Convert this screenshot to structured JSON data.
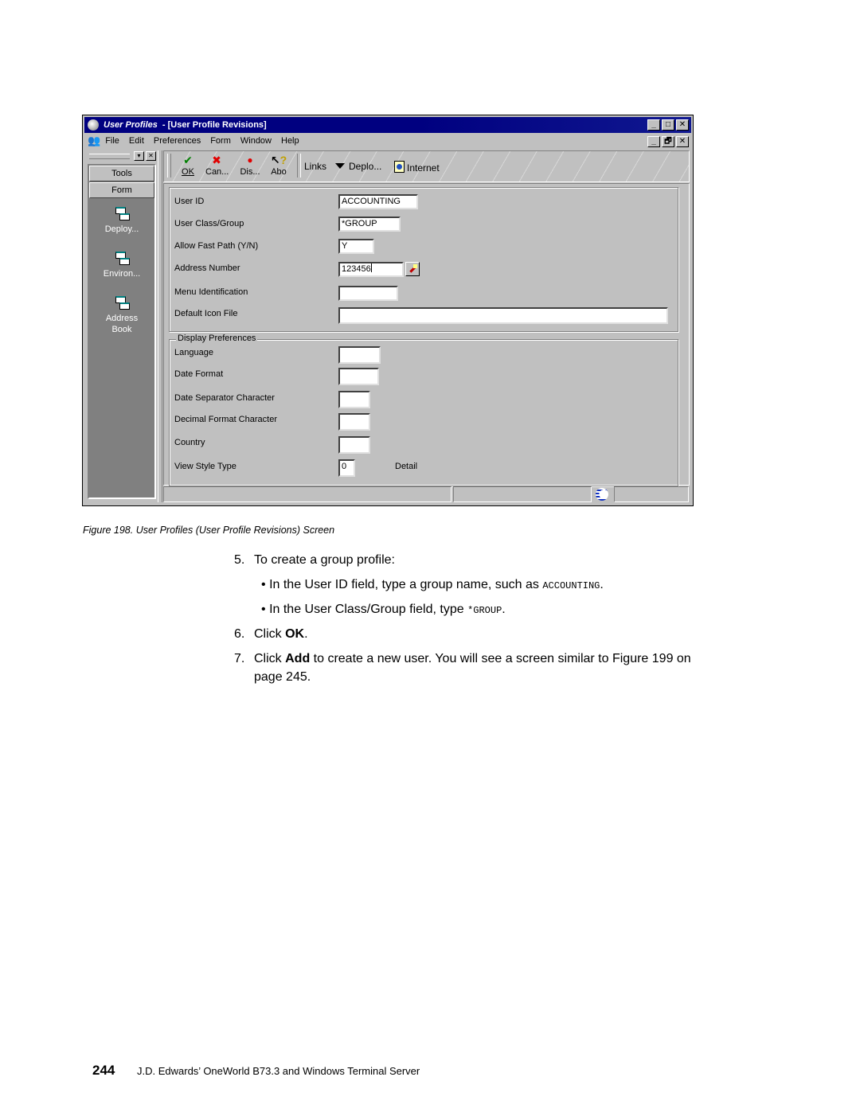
{
  "window": {
    "app_title": "User Profiles",
    "form_title": "- [User Profile Revisions]",
    "title_buttons": [
      "_",
      "□",
      "✕"
    ],
    "mdi_buttons": [
      "_",
      "🗗",
      "✕"
    ]
  },
  "menubar": {
    "items": [
      {
        "label": "File",
        "accel": "F"
      },
      {
        "label": "Edit",
        "accel": "E"
      },
      {
        "label": "Preferences",
        "accel": "P"
      },
      {
        "label": "Form",
        "accel": "m"
      },
      {
        "label": "Window",
        "accel": "W"
      },
      {
        "label": "Help",
        "accel": "H"
      }
    ]
  },
  "left_pane": {
    "tabs": [
      "Tools",
      "Form"
    ],
    "items": [
      {
        "label": "Deploy...",
        "icon": "exit-icon"
      },
      {
        "label": "Environ...",
        "icon": "exit-icon"
      },
      {
        "label": "Address Book",
        "icon": "exit-icon"
      }
    ]
  },
  "toolbar": {
    "buttons": [
      {
        "label": "OK",
        "icon": "checkmark-icon",
        "glyph": "✔",
        "color": "#008000"
      },
      {
        "label": "Can...",
        "icon": "cancel-x-icon",
        "glyph": "✖",
        "color": "#e00000"
      },
      {
        "label": "Dis...",
        "icon": "display-binoculars-icon",
        "glyph": "🔭",
        "color": "#e00000"
      },
      {
        "label": "Abo",
        "icon": "about-help-icon",
        "glyph": "?",
        "color": "#c0a000"
      }
    ],
    "links_label": "Links",
    "deploy_label": "Deplo...",
    "internet_label": "Internet"
  },
  "form": {
    "fields": [
      {
        "label": "User ID",
        "value": "ACCOUNTING"
      },
      {
        "label": "User Class/Group",
        "value": "*GROUP"
      },
      {
        "label": "Allow Fast Path (Y/N)",
        "value": "Y"
      },
      {
        "label": "Address Number",
        "value": "123456"
      },
      {
        "label": "Menu Identification",
        "value": ""
      },
      {
        "label": "Default Icon File",
        "value": ""
      }
    ],
    "display_prefs": {
      "legend": "Display Preferences",
      "fields": [
        {
          "label": "Language",
          "value": ""
        },
        {
          "label": "Date Format",
          "value": ""
        },
        {
          "label": "Date Separator Character",
          "value": ""
        },
        {
          "label": "Decimal Format Character",
          "value": ""
        },
        {
          "label": "Country",
          "value": ""
        },
        {
          "label": "View Style Type",
          "value": "0",
          "description": "Detail"
        }
      ]
    }
  },
  "document": {
    "caption": "Figure 198.  User Profiles (User Profile Revisions) Screen",
    "steps": [
      {
        "num": "5.",
        "text": "To create a group profile:"
      },
      {
        "num": "6.",
        "pre": "Click ",
        "bold": "OK",
        "post": "."
      },
      {
        "num": "7.",
        "pre": "Click ",
        "bold": "Add",
        "post": " to create a new user. You will see a screen similar to Figure 199 on",
        "line2": "page 245."
      }
    ],
    "bullets": [
      {
        "pre": "In the User ID field, type a group name, such as ",
        "code": "ACCOUNTING",
        "post": "."
      },
      {
        "pre": "In the User Class/Group field, type ",
        "code": "*GROUP",
        "post": "."
      }
    ],
    "footer": {
      "page_number": "244",
      "book_title": "J.D. Edwards’ OneWorld B73.3 and Windows Terminal Server"
    }
  }
}
